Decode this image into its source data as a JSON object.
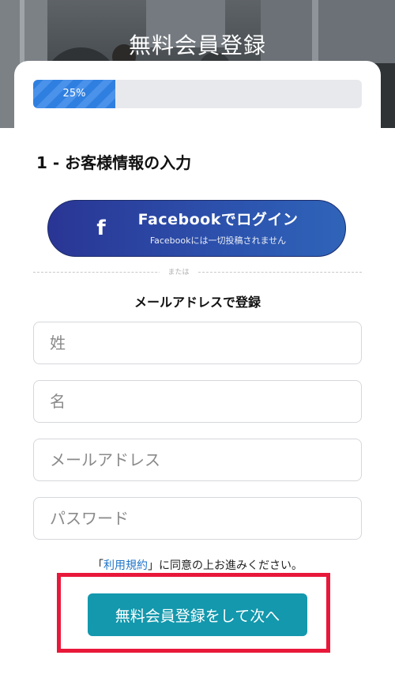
{
  "header": {
    "title": "無料会員登録"
  },
  "progress": {
    "value_percent": 25,
    "label": "25%"
  },
  "step": {
    "title": "1 - お客様情報の入力"
  },
  "facebook": {
    "icon": "facebook-icon",
    "icon_glyph": "f",
    "main_label": "Facebookでログイン",
    "sub_label": "Facebookには一切投稿されません"
  },
  "divider": {
    "label": "または"
  },
  "email_section": {
    "title": "メールアドレスで登録"
  },
  "form": {
    "last_name_placeholder": "姓",
    "first_name_placeholder": "名",
    "email_placeholder": "メールアドレス",
    "password_placeholder": "パスワード"
  },
  "terms": {
    "open_quote": "「",
    "link": "利用規約",
    "rest": "」に同意の上お進みください。"
  },
  "submit": {
    "label": "無料会員登録をして次へ"
  },
  "colors": {
    "accent": "#1398ad",
    "progress": "#2f7fe0",
    "facebook": "#2a3594",
    "highlight": "#e8183a",
    "link": "#1f75c9"
  }
}
